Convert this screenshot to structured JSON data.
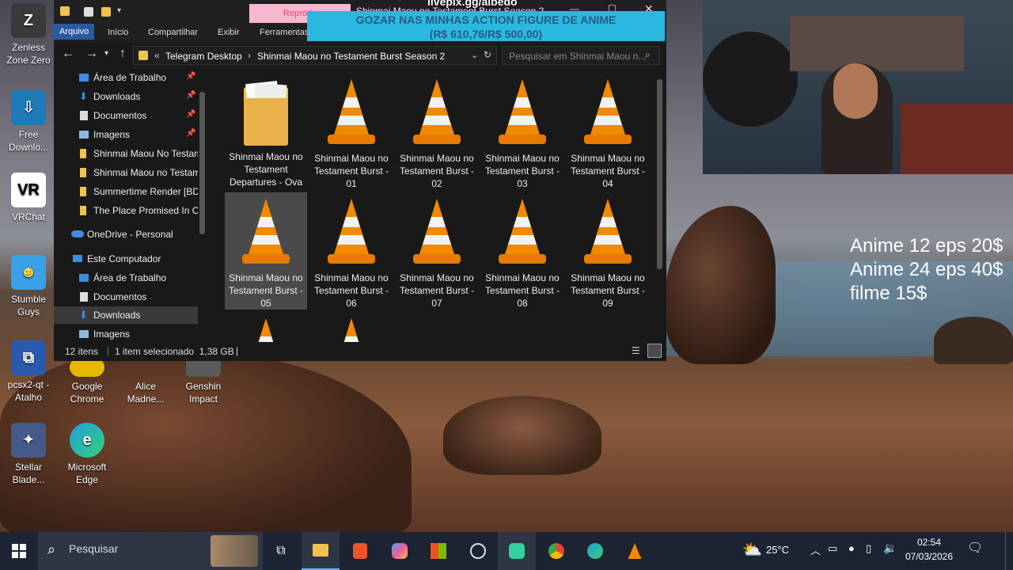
{
  "desktop_icons": [
    {
      "label": "Zenless Zone Zero",
      "color": "#2a2a2a"
    },
    {
      "label": "Free Downlo...",
      "color": "#1e7ab8"
    },
    {
      "label": "VRChat",
      "color": "#ffffff"
    },
    {
      "label": "Stumble Guys",
      "color": "#3aa0e8"
    },
    {
      "label": "pcsx2-qt - Atalho",
      "color": "#2a5ab0"
    },
    {
      "label": "Stellar Blade...",
      "color": "#455a88"
    },
    {
      "label": "Google Chrome",
      "color": "#e6b800"
    },
    {
      "label": "Alice Madne...",
      "color": "#333333"
    },
    {
      "label": "Genshin Impact",
      "color": "#5a5a5a"
    },
    {
      "label": "Microsoft Edge",
      "color": "#1aa0d8"
    }
  ],
  "explorer": {
    "ribbon_tabs": [
      "Arquivo",
      "Início",
      "Compartilhar",
      "Exibir",
      "Ferramentas"
    ],
    "address": {
      "prefix": "«",
      "crumbs": [
        "Telegram Desktop",
        "Shinmai Maou no Testament Burst Season 2"
      ]
    },
    "search_placeholder": "Pesquisar em Shinmai Maou n...",
    "nav_items": [
      {
        "label": "Área de Trabalho",
        "icon": "desktop-icon",
        "pinned": true
      },
      {
        "label": "Downloads",
        "icon": "download-icon",
        "pinned": true
      },
      {
        "label": "Documentos",
        "icon": "document-icon",
        "pinned": true
      },
      {
        "label": "Imagens",
        "icon": "image-icon",
        "pinned": true
      },
      {
        "label": "Shinmai Maou No Testam",
        "icon": "folder-icon"
      },
      {
        "label": "Shinmai Maou no Testam",
        "icon": "folder-icon"
      },
      {
        "label": "Summertime Render [BD",
        "icon": "folder-icon"
      },
      {
        "label": "The Place Promised In Ou",
        "icon": "folder-icon"
      },
      {
        "label": "OneDrive - Personal",
        "icon": "cloud-icon"
      },
      {
        "label": "Este Computador",
        "icon": "computer-icon"
      },
      {
        "label": "Área de Trabalho",
        "icon": "desktop-icon"
      },
      {
        "label": "Documentos",
        "icon": "document-icon"
      },
      {
        "label": "Downloads",
        "icon": "download-icon",
        "selected": true
      },
      {
        "label": "Imagens",
        "icon": "image-icon"
      }
    ],
    "files": [
      {
        "name": "Shinmai Maou no Testament Departures - Ova",
        "type": "folder"
      },
      {
        "name": "Shinmai Maou no Testament Burst - 01",
        "type": "video"
      },
      {
        "name": "Shinmai Maou no Testament Burst - 02",
        "type": "video"
      },
      {
        "name": "Shinmai Maou no Testament Burst - 03",
        "type": "video"
      },
      {
        "name": "Shinmai Maou no Testament Burst - 04",
        "type": "video"
      },
      {
        "name": "Shinmai Maou no Testament Burst - 05",
        "type": "video",
        "selected": true
      },
      {
        "name": "Shinmai Maou no Testament Burst - 06",
        "type": "video"
      },
      {
        "name": "Shinmai Maou no Testament Burst - 07",
        "type": "video"
      },
      {
        "name": "Shinmai Maou no Testament Burst - 08",
        "type": "video"
      },
      {
        "name": "Shinmai Maou no Testament Burst - 09",
        "type": "video"
      },
      {
        "name": "",
        "type": "video"
      },
      {
        "name": "",
        "type": "video"
      }
    ],
    "status": {
      "count": "12 itens",
      "selection": "1 item selecionado  1,38 GB"
    }
  },
  "overlays": {
    "top_text": "livepix.gg/albedo",
    "pink_text": "Reprodu",
    "window_title_fragment": "Shinmai Maou no Testament Burst Season 2",
    "banner_line1": "GOZAR NAS MINHAS ACTION FIGURE DE ANIME",
    "banner_line2": "(R$ 610,76/R$ 500,00)"
  },
  "price_list": [
    "Anime 12 eps 20$",
    "Anime 24 eps 40$",
    "filme 15$"
  ],
  "taskbar": {
    "search_label": "Pesquisar",
    "weather": "25°C",
    "time": "02:54",
    "date": "07/03/2026"
  },
  "colors": {
    "accent": "#2b5aa0",
    "vlc_orange": "#f08a00",
    "folder_yellow": "#f2c14e"
  }
}
